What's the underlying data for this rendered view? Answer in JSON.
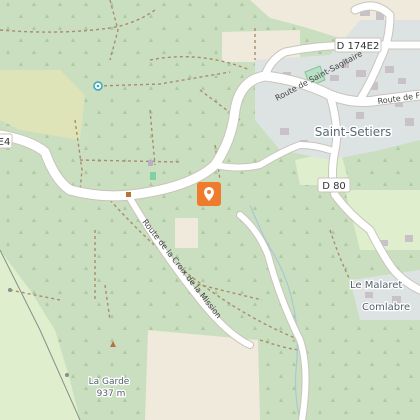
{
  "map": {
    "road_labels": {
      "d174e2": "D 174E2",
      "d80": "D 80",
      "e4_fragment": "E4",
      "saint_sagitaire": "Route de Saint-Sagitaire",
      "croix_mission": "Route de la Croix de la Mission",
      "route_fragment": "Route de F"
    },
    "places": {
      "saint_setiers": "Saint-Setiers",
      "le_malaret": "Le Malaret",
      "comlabre": "Comlabre",
      "la_garde": "La Garde",
      "la_garde_elev": "937 m"
    },
    "colors": {
      "forest": "#c9dfc0",
      "meadow": "#dfeecc",
      "field": "#efeadc",
      "road": "#ffffff",
      "road_casing": "#c9c4bb",
      "town": "#dde3e3",
      "marker": "#f07b2c",
      "path": "#a88d6c"
    },
    "marker": {
      "icon": "map-pin-icon"
    }
  }
}
